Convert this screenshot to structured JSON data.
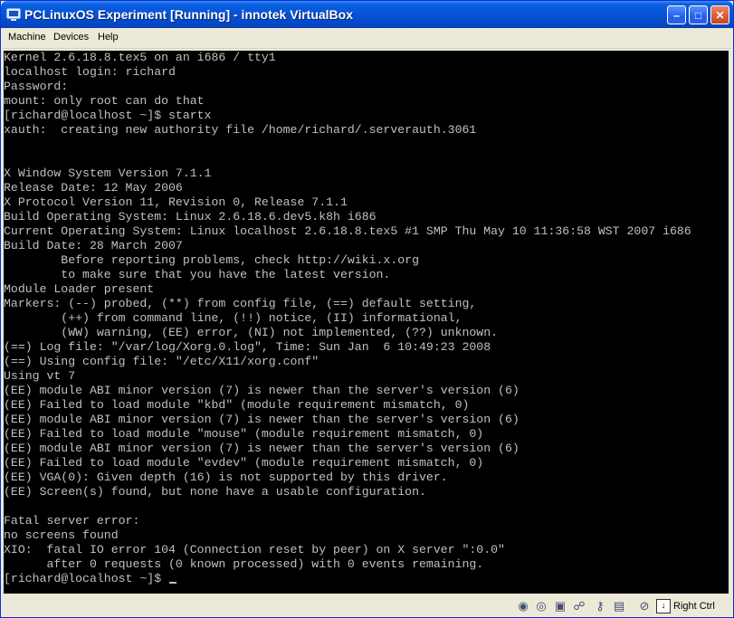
{
  "window": {
    "title": "PCLinuxOS Experiment [Running] - innotek VirtualBox",
    "minimize_glyph": "‒",
    "maximize_glyph": "□",
    "close_glyph": "✕"
  },
  "menu": {
    "items": [
      "Machine",
      "Devices",
      "Help"
    ]
  },
  "console": {
    "lines": [
      "Kernel 2.6.18.8.tex5 on an i686 / tty1",
      "localhost login: richard",
      "Password:",
      "mount: only root can do that",
      "[richard@localhost ~]$ startx",
      "xauth:  creating new authority file /home/richard/.serverauth.3061",
      "",
      "",
      "X Window System Version 7.1.1",
      "Release Date: 12 May 2006",
      "X Protocol Version 11, Revision 0, Release 7.1.1",
      "Build Operating System: Linux 2.6.18.6.dev5.k8h i686",
      "Current Operating System: Linux localhost 2.6.18.8.tex5 #1 SMP Thu May 10 11:36:58 WST 2007 i686",
      "Build Date: 28 March 2007",
      "        Before reporting problems, check http://wiki.x.org",
      "        to make sure that you have the latest version.",
      "Module Loader present",
      "Markers: (--) probed, (**) from config file, (==) default setting,",
      "        (++) from command line, (!!) notice, (II) informational,",
      "        (WW) warning, (EE) error, (NI) not implemented, (??) unknown.",
      "(==) Log file: \"/var/log/Xorg.0.log\", Time: Sun Jan  6 10:49:23 2008",
      "(==) Using config file: \"/etc/X11/xorg.conf\"",
      "Using vt 7",
      "(EE) module ABI minor version (7) is newer than the server's version (6)",
      "(EE) Failed to load module \"kbd\" (module requirement mismatch, 0)",
      "(EE) module ABI minor version (7) is newer than the server's version (6)",
      "(EE) Failed to load module \"mouse\" (module requirement mismatch, 0)",
      "(EE) module ABI minor version (7) is newer than the server's version (6)",
      "(EE) Failed to load module \"evdev\" (module requirement mismatch, 0)",
      "(EE) VGA(0): Given depth (16) is not supported by this driver.",
      "(EE) Screen(s) found, but none have a usable configuration.",
      "",
      "Fatal server error:",
      "no screens found",
      "XIO:  fatal IO error 104 (Connection reset by peer) on X server \":0.0\"",
      "      after 0 requests (0 known processed) with 0 events remaining.",
      "[richard@localhost ~]$ "
    ]
  },
  "statusbar": {
    "icons": [
      "hard-disk-icon",
      "cdrom-icon",
      "floppy-icon",
      "network-icon",
      "usb-icon",
      "shared-folder-icon",
      "mouse-integration-icon",
      "keyboard-capture-icon"
    ],
    "host_key": "Right Ctrl"
  }
}
